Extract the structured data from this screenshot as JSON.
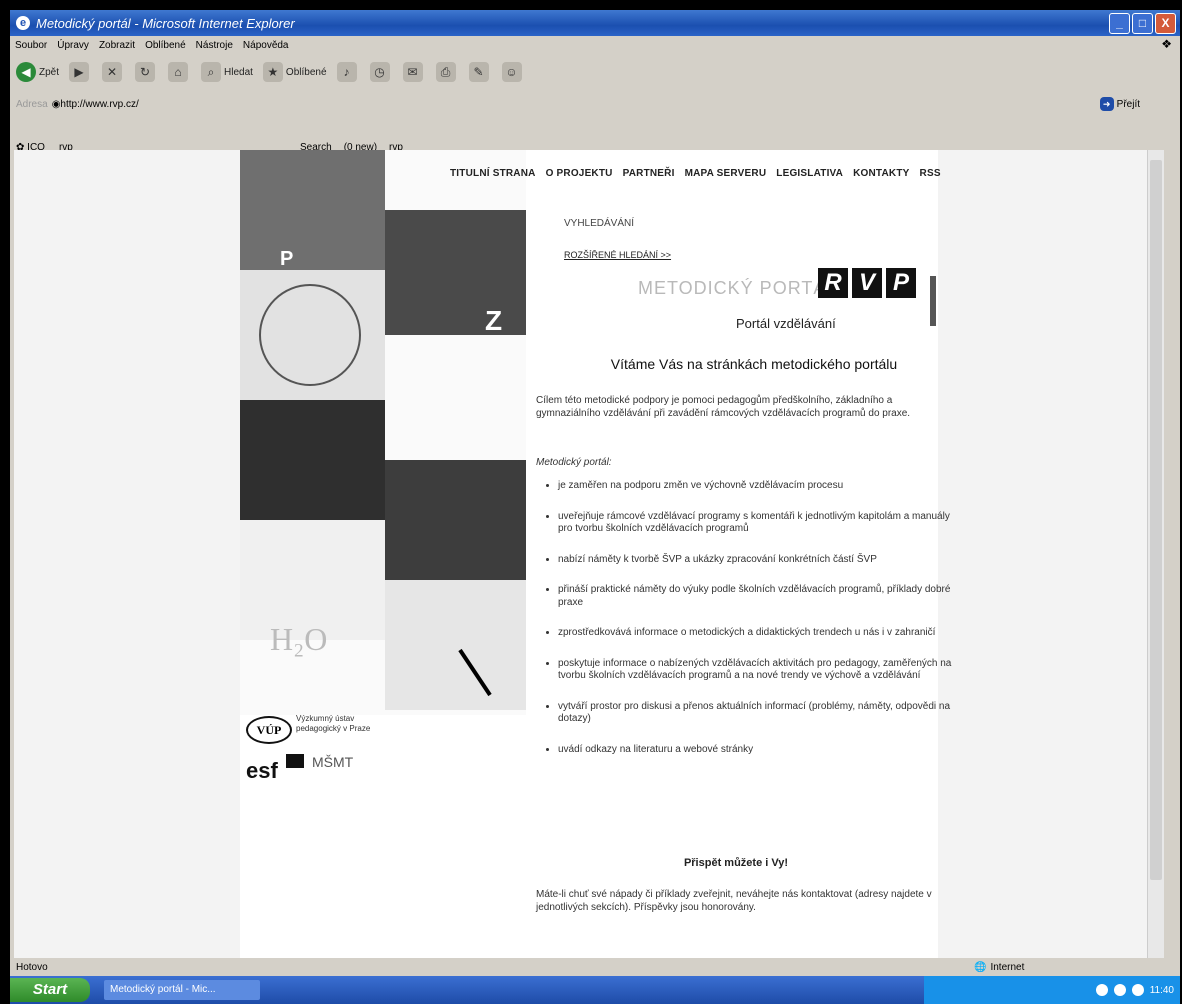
{
  "window": {
    "title": "Metodický portál - Microsoft Internet Explorer",
    "controls": [
      "_",
      "□",
      "X"
    ]
  },
  "menubar": [
    "Soubor",
    "Úpravy",
    "Zobrazit",
    "Oblíbené",
    "Nástroje",
    "Nápověda"
  ],
  "toolbar": {
    "back": "Zpět",
    "search": "Hledat",
    "favorites": "Oblíbené"
  },
  "address": {
    "label": "Adresa",
    "url": "http://www.rvp.cz/",
    "go": "Přejít"
  },
  "links": {
    "icq": "ICQ",
    "rvp": "rvp",
    "search": "Search",
    "new": "(0 new)",
    "rvp2": "rvp"
  },
  "nav": [
    "TITULNÍ STRANA",
    "O PROJEKTU",
    "PARTNEŘI",
    "MAPA SERVERU",
    "LEGISLATIVA",
    "KONTAKTY",
    "RSS"
  ],
  "search": {
    "label": "VYHLEDÁVÁNÍ",
    "advanced": "ROZŠÍŘENÉ HLEDÁNÍ >>"
  },
  "brand": {
    "text": "METODICKÝ PORTÁL",
    "letters": [
      "R",
      "V",
      "P"
    ],
    "subtitle": "Portál vzdělávání"
  },
  "heading": "Vítáme Vás na stránkách metodického portálu",
  "intro": "Cílem této metodické podpory je pomoci pedagogům předškolního, základního a gymnaziálního vzdělávání při zavádění rámcových vzdělávacích programů do praxe.",
  "italic_label": "Metodický portál:",
  "bullets": [
    "je zaměřen na podporu změn ve výchovně vzdělávacím procesu",
    "uveřejňuje rámcové vzdělávací programy s komentáři k jednotlivým kapitolám a manuály pro tvorbu školních vzdělávacích programů",
    "nabízí náměty k tvorbě ŠVP a ukázky zpracování konkrétních částí ŠVP",
    "přináší praktické náměty do výuky podle školních vzdělávacích programů, příklady dobré praxe",
    "zprostředkovává informace o metodických a didaktických trendech u nás i v zahraničí",
    "poskytuje informace o nabízených vzdělávacích aktivitách pro pedagogy, zaměřených na tvorbu školních vzdělávacích programů a na nové trendy ve výchově a vzdělávání",
    "vytváří prostor pro diskusi a přenos aktuálních informací (problémy, náměty, odpovědi na dotazy)",
    "uvádí odkazy na literaturu a webové stránky"
  ],
  "contribute": "Přispět můžete i Vy!",
  "outro": "Máte-li chuť své nápady či příklady zveřejnit, neváhejte nás kontaktovat (adresy najdete v jednotlivých sekcích). Příspěvky jsou honorovány.",
  "logos": {
    "vup": "VÚP",
    "vup_text": "Výzkumný ústav pedagogický v Praze",
    "esf": "esf",
    "msmt": "MŠMT"
  },
  "status": {
    "left": "Hotovo",
    "zone": "Internet"
  },
  "taskbar": {
    "start": "Start",
    "task": "Metodický portál - Mic...",
    "time": "11:40"
  },
  "colors": {
    "title_blue": "#2456b5",
    "rvp_bg": "#111111",
    "task_green": "#2f8b2a"
  }
}
